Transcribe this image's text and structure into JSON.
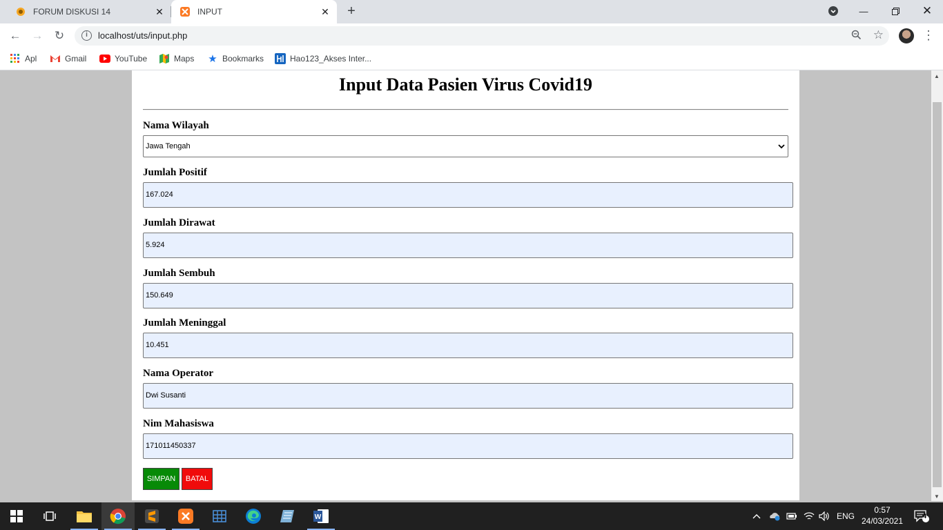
{
  "browser": {
    "tabs": [
      {
        "title": "FORUM DISKUSI 14",
        "active": false
      },
      {
        "title": "INPUT",
        "active": true
      }
    ],
    "url": "localhost/uts/input.php",
    "bookmarks": [
      {
        "label": "Apl",
        "icon": "apps-grid-icon"
      },
      {
        "label": "Gmail",
        "icon": "gmail-icon"
      },
      {
        "label": "YouTube",
        "icon": "youtube-icon"
      },
      {
        "label": "Maps",
        "icon": "maps-icon"
      },
      {
        "label": "Bookmarks",
        "icon": "star-icon"
      },
      {
        "label": "Hao123_Akses Inter...",
        "icon": "hao123-icon"
      }
    ]
  },
  "form": {
    "title": "Input Data Pasien Virus Covid19",
    "wilayah": {
      "label": "Nama Wilayah",
      "value": "Jawa Tengah"
    },
    "positif": {
      "label": "Jumlah Positif",
      "value": "167.024"
    },
    "dirawat": {
      "label": "Jumlah Dirawat",
      "value": "5.924"
    },
    "sembuh": {
      "label": "Jumlah Sembuh",
      "value": "150.649"
    },
    "meninggal": {
      "label": "Jumlah Meninggal",
      "value": "10.451"
    },
    "operator": {
      "label": "Nama Operator",
      "value": "Dwi Susanti"
    },
    "nim": {
      "label": "Nim Mahasiswa",
      "value": "171011450337"
    },
    "submit_label": "SIMPAN",
    "cancel_label": "BATAL"
  },
  "taskbar": {
    "lang": "ENG",
    "time": "0:57",
    "date": "24/03/2021",
    "notifications": "4"
  },
  "colors": {
    "simpan": "#078a07",
    "batal": "#f00b0b",
    "autofill": "#e8f0fe",
    "background": "#c3c3c3"
  }
}
